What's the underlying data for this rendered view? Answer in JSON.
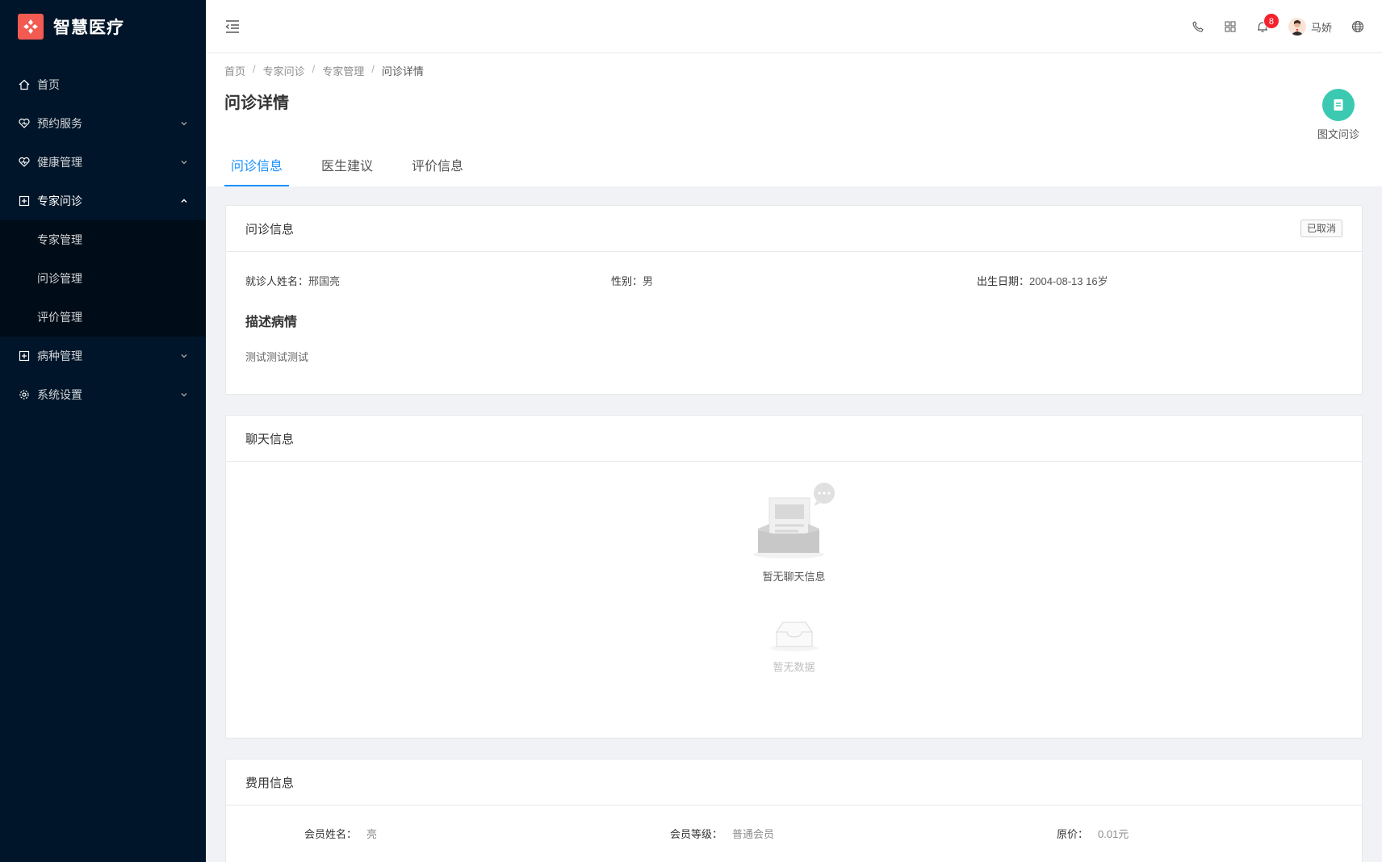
{
  "app": {
    "name": "智慧医疗",
    "logo_icon": "hospital-cross-logo"
  },
  "sidebar": {
    "items": [
      {
        "label": "首页",
        "icon": "home-icon",
        "has_children": false
      },
      {
        "label": "预约服务",
        "icon": "heart-icon",
        "has_children": true
      },
      {
        "label": "健康管理",
        "icon": "heartbeat-icon",
        "has_children": true
      },
      {
        "label": "专家问诊",
        "icon": "medical-box-icon",
        "has_children": true,
        "open": true,
        "children": [
          {
            "label": "专家管理"
          },
          {
            "label": "问诊管理"
          },
          {
            "label": "评价管理"
          }
        ]
      },
      {
        "label": "病种管理",
        "icon": "medical-box-icon",
        "has_children": true
      },
      {
        "label": "系统设置",
        "icon": "gear-icon",
        "has_children": true
      }
    ]
  },
  "header": {
    "notification_count": "8",
    "user_name": "马娇",
    "icons": [
      "phone-icon",
      "grid-icon",
      "bell-icon",
      "globe-icon"
    ]
  },
  "breadcrumb": [
    "首页",
    "专家问诊",
    "专家管理",
    "问诊详情"
  ],
  "page": {
    "title": "问诊详情",
    "consult_type": "图文问诊",
    "tabs": [
      "问诊信息",
      "医生建议",
      "评价信息"
    ],
    "active_tab": 0
  },
  "consult_info": {
    "title": "问诊信息",
    "status": "已取消",
    "patient_name_label": "就诊人姓名：",
    "patient_name": "邢国亮",
    "gender_label": "性别：",
    "gender": "男",
    "birth_label": "出生日期：",
    "birth": "2004-08-13 16岁",
    "desc_title": "描述病情",
    "desc_text": "测试测试测试"
  },
  "chat_info": {
    "title": "聊天信息",
    "empty_text": "暂无聊天信息",
    "no_data_text": "暂无数据"
  },
  "fee_info": {
    "title": "费用信息",
    "row1": [
      {
        "label": "会员姓名：",
        "value": "亮"
      },
      {
        "label": "会员等级：",
        "value": "普通会员"
      },
      {
        "label": "原价：",
        "value": "0.01元"
      }
    ]
  },
  "colors": {
    "sidebar_bg": "#001529",
    "accent": "#1890ff",
    "consult_green": "#3cc9b1",
    "badge_red": "#f5222d",
    "logo_red": "#f25a52"
  }
}
